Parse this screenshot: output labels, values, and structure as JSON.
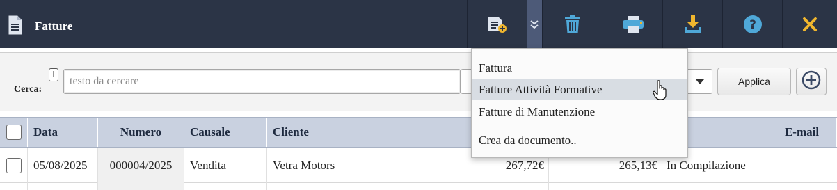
{
  "window": {
    "title": "Fatture"
  },
  "toolbar": {
    "buttons": [
      {
        "name": "new",
        "icon": "new-document-icon"
      },
      {
        "name": "more",
        "icon": "double-chevron-down-icon"
      },
      {
        "name": "delete",
        "icon": "trash-icon"
      },
      {
        "name": "print",
        "icon": "printer-icon"
      },
      {
        "name": "download",
        "icon": "download-icon"
      },
      {
        "name": "help",
        "icon": "help-icon"
      },
      {
        "name": "close",
        "icon": "close-icon"
      }
    ],
    "accent_color": "#f0b62e",
    "icon_color": "#4fa8d8",
    "background": "#2b3446"
  },
  "filter": {
    "search_label": "Cerca:",
    "info_icon": "i",
    "search_placeholder": "testo da cercare",
    "search_value": "",
    "apply_label": "Applica",
    "add_icon": "plus-circle-icon"
  },
  "table": {
    "columns": [
      "",
      "Data",
      "Numero",
      "Causale",
      "Cliente",
      "",
      "",
      "to",
      "E-mail"
    ],
    "rows": [
      {
        "data": "05/08/2025",
        "numero": "000004/2025",
        "causale": "Vendita",
        "cliente": "Vetra Motors",
        "importo": "267,72€",
        "imponibile": "265,13€",
        "stato": "In Compilazione",
        "email": ""
      }
    ]
  },
  "menu": {
    "items": [
      {
        "label": "Fattura",
        "hover": false
      },
      {
        "label": "Fatture Attività Formative",
        "hover": true
      },
      {
        "label": "Fatture di Manutenzione",
        "hover": false
      }
    ],
    "footer_item": "Crea da documento.."
  }
}
